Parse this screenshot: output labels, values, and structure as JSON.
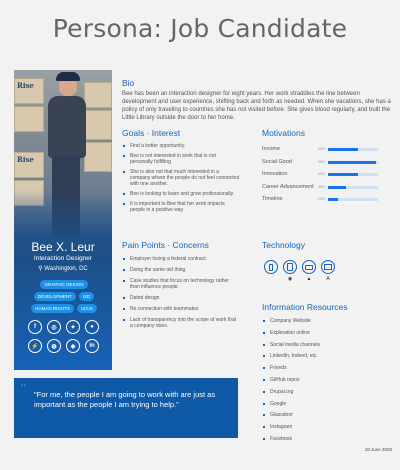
{
  "page": {
    "title": "Persona: Job Candidate",
    "date": "18 June 2020"
  },
  "card": {
    "name": "Bee X. Leur",
    "role": "Interaction Designer",
    "location": "Washington, DC",
    "photo_sign": "Rise",
    "tags": [
      "GRAPHIC DESIGN",
      "DEVELOPMENT",
      "IXD",
      "HUMAN RIGHTS",
      "UI/UX"
    ],
    "socials": [
      {
        "icon": "facebook-icon",
        "glyph": "f"
      },
      {
        "icon": "instagram-icon",
        "glyph": "◎"
      },
      {
        "icon": "twitter-icon",
        "glyph": "✦"
      },
      {
        "icon": "reddit-icon",
        "glyph": "●"
      },
      {
        "icon": "messenger-icon",
        "glyph": "⚡"
      },
      {
        "icon": "dribbble-icon",
        "glyph": "◍"
      },
      {
        "icon": "git-icon",
        "glyph": "◆"
      },
      {
        "icon": "linkedin-icon",
        "glyph": "in"
      }
    ]
  },
  "bio": {
    "heading": "Bio",
    "text": "Bee has been an interaction designer for eight years. Her work straddles the line between development and user experience, shifting back and forth as needed. When she vacations, she has a policy of only traveling to countries she has not visited before. She gives blood regularly, and built the Little Library outside the door to her home."
  },
  "goals": {
    "heading": "Goals · Interest",
    "items": [
      "Find a better opportunity.",
      "Bee is not interested in work that is not personally fulfilling",
      "She is also not that much interested in a company where the people do not feel connected with one another.",
      "Bee is looking to learn and grow professionally.",
      "It is important to Bee that her work impacts people in a positive way"
    ]
  },
  "motivations": {
    "heading": "Motivations",
    "items": [
      {
        "label": "Income",
        "value": "60%",
        "fill": 0.6
      },
      {
        "label": "Social Good",
        "value": "95%",
        "fill": 0.95
      },
      {
        "label": "Innovation",
        "value": "60%",
        "fill": 0.6
      },
      {
        "label": "Career Advancement",
        "value": "35%",
        "fill": 0.35
      },
      {
        "label": "Timeline",
        "value": "20%",
        "fill": 0.2
      }
    ]
  },
  "pain": {
    "heading": "Pain Points · Concerns",
    "items": [
      "Employer losing a federal contract.",
      "Doing the same old thing.",
      "Case studies that focus on technology rather than influence people.",
      "Dated design",
      "No connection with teammates",
      "Lack of transparency into the scope of work that a company does."
    ]
  },
  "technology": {
    "heading": "Technology",
    "devices": [
      "smartphone-icon",
      "tablet-icon",
      "laptop-icon",
      "desktop-icon"
    ],
    "platforms": [
      {
        "icon": "apple-icon",
        "glyph": ""
      },
      {
        "icon": "chrome-icon",
        "glyph": "◉"
      },
      {
        "icon": "android-icon",
        "glyph": "▲"
      },
      {
        "icon": "a-icon",
        "glyph": "A"
      }
    ]
  },
  "resources": {
    "heading": "Information Resources",
    "items": [
      "Company Website",
      "Exploration online",
      "Social media channels",
      "LinkedIn, Indeed, etc.",
      "Friends",
      "GitHub repos",
      "Drupal.org",
      "Google",
      "Glassdoor",
      "Instagram",
      "Facebook"
    ]
  },
  "quote": {
    "mark": "“",
    "text": "\"For me, the people I am going to work with are just as important as the people I am trying to help.\""
  },
  "colors": {
    "accent": "#1565c0",
    "card": "#1d4f86",
    "bar": "#1a73e8",
    "quote": "#0f5aa6"
  }
}
